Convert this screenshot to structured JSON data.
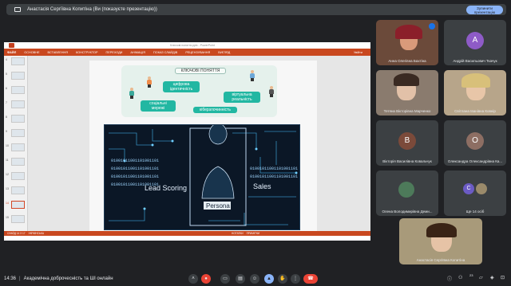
{
  "presenter_bar": {
    "text": "Анастасія Сергіївна Копитіна (Ви (показуєте презентацію))",
    "stop_label": "Зупинити презентацію"
  },
  "ppt": {
    "doc_title": "Ключові поняття.pptx - PowerPoint",
    "tabs": [
      "ФАЙЛ",
      "ОСНОВНЕ",
      "ВСТАВЛЕННЯ",
      "КОНСТРУКТОР",
      "ПЕРЕХОДИ",
      "АНІМАЦІЯ",
      "ПОКАЗ СЛАЙДІВ",
      "РЕЦЕНЗУВАННЯ",
      "ВИГЛЯД"
    ],
    "account": "Увійти",
    "thumb_numbers": [
      "4",
      "5",
      "6",
      "7",
      "8",
      "9",
      "10",
      "11",
      "12",
      "13",
      "14",
      "15"
    ],
    "status_left": "СЛАЙД 14 З 17",
    "status_lang": "УКРАЇНСЬКА",
    "status_notes": "НОТАТКИ",
    "status_comments": "ПРИМІТКИ",
    "slide": {
      "title": "КЛЮЧОВІ ПОНЯТТЯ",
      "pills": [
        "цифрова ідентичність",
        "віртуальна реальність",
        "соціальні мережі",
        "кіберзлочинність"
      ],
      "image_labels": [
        "Lead Scoring",
        "Persona",
        "Sales"
      ],
      "binary": "01001011001101001101"
    }
  },
  "participants": [
    {
      "name": "Анна Олегівна Бахтіна",
      "type": "video"
    },
    {
      "name": "Андрій Васильович Ткачук",
      "type": "avatar",
      "initial": "А",
      "color": "#8e5bc7"
    },
    {
      "name": "Тетяна Вікторівна Марченко",
      "type": "video"
    },
    {
      "name": "Світлана Іванівна Ковнір",
      "type": "video"
    },
    {
      "name": "Вікторія Василівна Ковальчук",
      "type": "avatar",
      "initial": "В",
      "color": "#7b4a3a"
    },
    {
      "name": "Олександра Олександрівна Ка...",
      "type": "avatar",
      "initial": "О",
      "color": "#8d6e63"
    },
    {
      "name": "Олена Володимирівна Деми...",
      "type": "video"
    },
    {
      "name": "Ще 14 осіб",
      "type": "more",
      "initial": "С",
      "color": "#6b5bc4"
    },
    {
      "name": "Анастасія Сергіївна Копитіна",
      "type": "self"
    }
  ],
  "bottom_bar": {
    "time": "14:36",
    "separator": "|",
    "meeting_name": "Академічна доброчесність та ШІ онлайн",
    "participant_count": "23"
  },
  "colors": {
    "accent": "#8ab4f8",
    "ppt_orange": "#c9481f",
    "pill_teal": "#22b7a2",
    "end_red": "#ea4335"
  }
}
